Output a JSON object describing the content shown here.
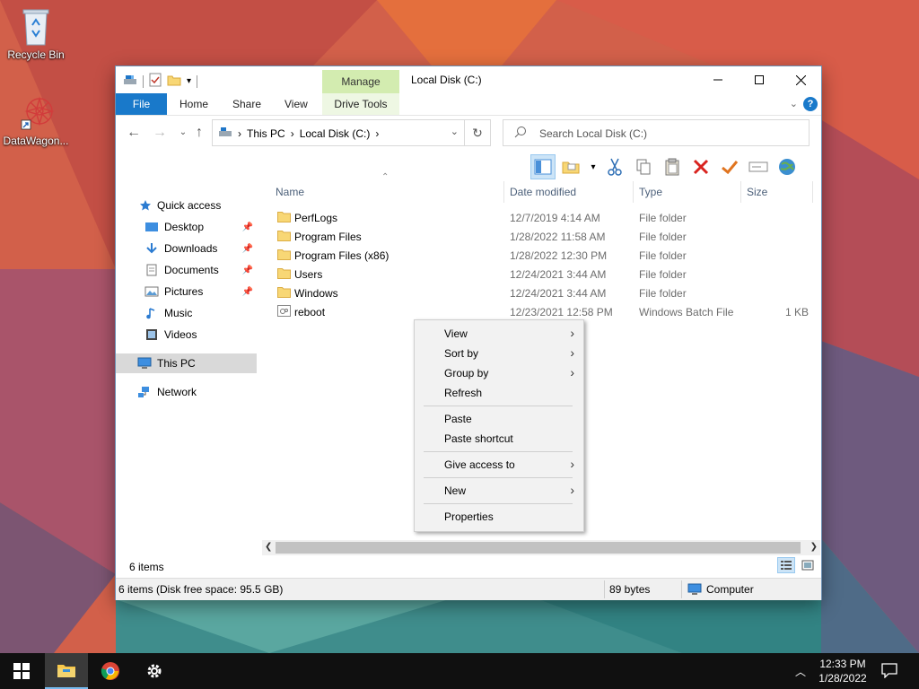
{
  "desktop": {
    "icons": [
      {
        "label": "Recycle Bin"
      },
      {
        "label": "DataWagon..."
      }
    ]
  },
  "window": {
    "title": "Local Disk (C:)",
    "contextual_tab": "Manage",
    "ribbon_tabs": [
      "File",
      "Home",
      "Share",
      "View",
      "Drive Tools"
    ],
    "controls": {
      "minimize": "—",
      "maximize": "☐",
      "close": "✕"
    }
  },
  "address": {
    "crumbs": [
      "This PC",
      "Local Disk (C:)"
    ],
    "search_placeholder": "Search Local Disk (C:)"
  },
  "nav": {
    "quick_access": "Quick access",
    "items": [
      "Desktop",
      "Downloads",
      "Documents",
      "Pictures",
      "Music",
      "Videos"
    ],
    "this_pc": "This PC",
    "network": "Network"
  },
  "columns": {
    "name": "Name",
    "date": "Date modified",
    "type": "Type",
    "size": "Size"
  },
  "files": [
    {
      "name": "PerfLogs",
      "date": "12/7/2019 4:14 AM",
      "type": "File folder",
      "size": "",
      "icon": "folder-icon"
    },
    {
      "name": "Program Files",
      "date": "1/28/2022 11:58 AM",
      "type": "File folder",
      "size": "",
      "icon": "folder-icon"
    },
    {
      "name": "Program Files (x86)",
      "date": "1/28/2022 12:30 PM",
      "type": "File folder",
      "size": "",
      "icon": "folder-icon"
    },
    {
      "name": "Users",
      "date": "12/24/2021 3:44 AM",
      "type": "File folder",
      "size": "",
      "icon": "folder-icon"
    },
    {
      "name": "Windows",
      "date": "12/24/2021 3:44 AM",
      "type": "File folder",
      "size": "",
      "icon": "folder-icon"
    },
    {
      "name": "reboot",
      "date": "12/23/2021 12:58 PM",
      "type": "Windows Batch File",
      "size": "1 KB",
      "icon": "batch-file-icon"
    }
  ],
  "context_menu": [
    {
      "label": "View",
      "submenu": true
    },
    {
      "label": "Sort by",
      "submenu": true
    },
    {
      "label": "Group by",
      "submenu": true
    },
    {
      "label": "Refresh",
      "submenu": false
    },
    {
      "label": "Paste",
      "submenu": false
    },
    {
      "label": "Paste shortcut",
      "submenu": false
    },
    {
      "label": "Give access to",
      "submenu": true
    },
    {
      "label": "New",
      "submenu": true
    },
    {
      "label": "Properties",
      "submenu": false
    }
  ],
  "status": {
    "item_count": "6 items",
    "detail": "6 items (Disk free space: 95.5 GB)",
    "size": "89 bytes",
    "location": "Computer"
  },
  "taskbar": {
    "time": "12:33 PM",
    "date": "1/28/2022"
  }
}
